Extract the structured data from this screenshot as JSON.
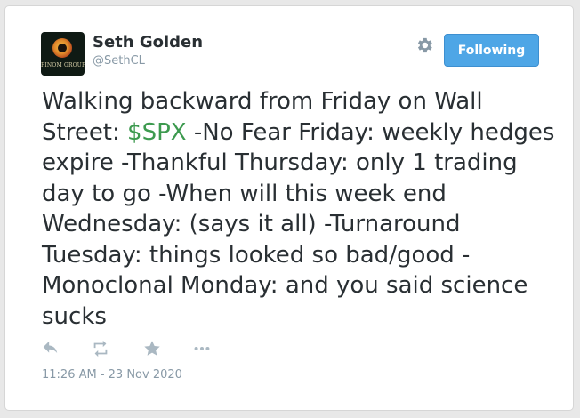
{
  "user": {
    "display_name": "Seth Golden",
    "handle": "@SethCL",
    "avatar_text": "FINOM GROUP"
  },
  "header": {
    "settings_icon": "gear-icon",
    "follow_label": "Following"
  },
  "tweet": {
    "text_before": "Walking backward from Friday on Wall Street: ",
    "cashtag": "$SPX",
    "text_after": " -No Fear Friday: weekly hedges expire -Thankful Thursday: only 1 trading day to go -When will this week end Wednesday: (says it all) -Turnaround Tuesday: things looked so bad/good -Monoclonal Monday: and you said science sucks"
  },
  "actions": {
    "icons": [
      "reply-icon",
      "retweet-icon",
      "favorite-icon",
      "more-icon"
    ]
  },
  "meta": {
    "timestamp": "11:26 AM - 23 Nov 2020"
  },
  "colors": {
    "follow_button": "#4ea6e6",
    "cashtag": "#3d9a4f",
    "text": "#292f33",
    "muted": "#8899a6",
    "icon": "#aab8c2"
  }
}
